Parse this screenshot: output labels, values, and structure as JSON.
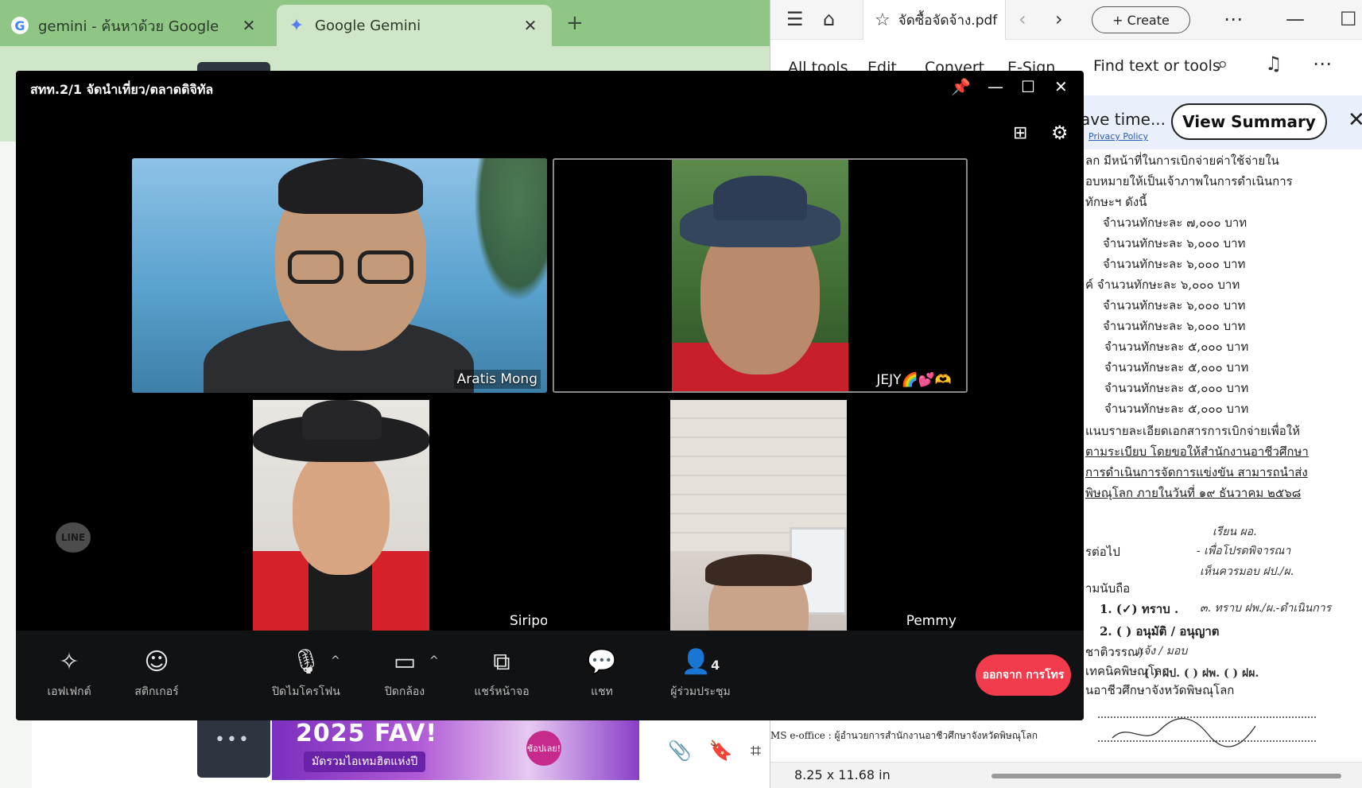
{
  "chrome": {
    "tabs": [
      {
        "label": "gemini - ค้นหาด้วย Google",
        "icon": "google-icon"
      },
      {
        "label": "Google Gemini",
        "icon": "gemini-sparkle-icon"
      }
    ],
    "new_tab_symbol": "+",
    "banner": {
      "headline": "2025 FAV!",
      "sub": "มัดรวมไอเทมฮิตแห่งปี",
      "badge": "ช้อปเลย!"
    }
  },
  "acrobat": {
    "file_tab": "จัดซื้อจัดจ้าง.pdf",
    "create_label": "+ Create",
    "menu": [
      "All tools",
      "Edit",
      "Convert",
      "E-Sign"
    ],
    "find_label": "Find text or tools",
    "promo_text": "ave time...",
    "privacy_label": "Privacy Policy",
    "view_summary_label": "View Summary",
    "page_size": "8.25 x 11.68 in",
    "pdf_lines": [
      "ลก มีหน้าที่ในการเบิกจ่ายค่าใช้จ่ายใน",
      "อบหมายให้เป็นเจ้าภาพในการดำเนินการ",
      "ทักษะฯ ดังนี้",
      "จำนวนทักษะละ ๗,๐๐๐ บาท",
      "จำนวนทักษะละ ๖,๐๐๐ บาท",
      "จำนวนทักษะละ ๖,๐๐๐ บาท",
      "ค์  จำนวนทักษะละ ๖,๐๐๐ บาท",
      "จำนวนทักษะละ ๖,๐๐๐ บาท",
      "จำนวนทักษะละ ๖,๐๐๐ บาท",
      "จำนวนทักษะละ ๕,๐๐๐ บาท",
      "จำนวนทักษะละ ๕,๐๐๐ บาท",
      "จำนวนทักษะละ ๕,๐๐๐ บาท",
      "จำนวนทักษะละ ๕,๐๐๐ บาท",
      "แนบรายละเอียดเอกสารการเบิกจ่ายเพื่อให้",
      "ตามระเบียบ โดยขอให้สำนักงานอาชีวศึกษา",
      "การดำเนินการจัดการแข่งขัน สามารถนำส่ง",
      "พิษณุโลก ภายในวันที่ ๑๙ ธันวาคม ๒๕๖๘",
      "รต่อไป",
      "ามนับถือ",
      "1. (✓) ทราบ .",
      "2. (  ) อนุมัติ / อนุญาต",
      "ชาติวรรณ)",
      "เทคนิคพิษณุโลก",
      "นอาชีวศึกษาจังหวัดพิษณุโลก",
      "MS e-office : ผู้อำนวยการสำนักงานอาชีวศึกษาจังหวัดพิษณุโลก"
    ],
    "handwriting": [
      "เรียน ผอ.",
      "- เพื่อโปรดพิจารณา",
      "เห็นควรมอบ ฝป./ผ.",
      "๓. ทราบ ฝพ./ผ.-ดำเนินการ",
      "( ) ฝป.  ( ) ฝพ.  ( ) ฝผ.",
      "แจ้ง / มอบ"
    ]
  },
  "call": {
    "title": "สทท.2/1 จัดนำเที่ยว/ตลาดดิจิทัล",
    "participants": [
      {
        "name": "Aratis Mong"
      },
      {
        "name": "JEJY🌈💕🫶"
      },
      {
        "name": "Siriporn"
      },
      {
        "name": "Pemmy"
      }
    ],
    "participant_count": "4",
    "controls": {
      "effects": "เอฟเฟกต์",
      "stickers": "สติกเกอร์",
      "mute": "ปิดไมโครโฟน",
      "camera": "ปิดกล้อง",
      "share": "แชร์หน้าจอ",
      "chat": "แชท",
      "participants": "ผู้ร่วมประชุม",
      "leave": "ออกจาก การโทร"
    },
    "logo_text": "LINE",
    "colors": {
      "leave": "#f23b4c",
      "bar": "#111214",
      "window": "#000000"
    }
  }
}
